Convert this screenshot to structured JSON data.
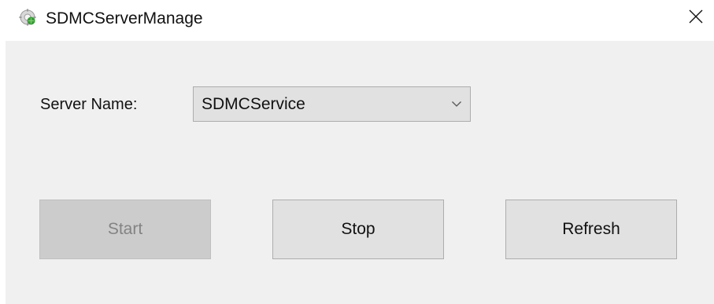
{
  "window": {
    "title": "SDMCServerManage",
    "app_icon": "gear-globe-icon",
    "close_icon": "close-icon"
  },
  "form": {
    "server_name_label": "Server Name:",
    "server_name_value": "SDMCService",
    "dropdown_icon": "chevron-down-icon"
  },
  "buttons": {
    "start": {
      "label": "Start",
      "enabled": false
    },
    "stop": {
      "label": "Stop",
      "enabled": true
    },
    "refresh": {
      "label": "Refresh",
      "enabled": true
    }
  },
  "colors": {
    "client_background": "#f0f0f0",
    "button_background": "#e1e1e1",
    "disabled_button_background": "#cccccc",
    "disabled_text": "#838383"
  }
}
